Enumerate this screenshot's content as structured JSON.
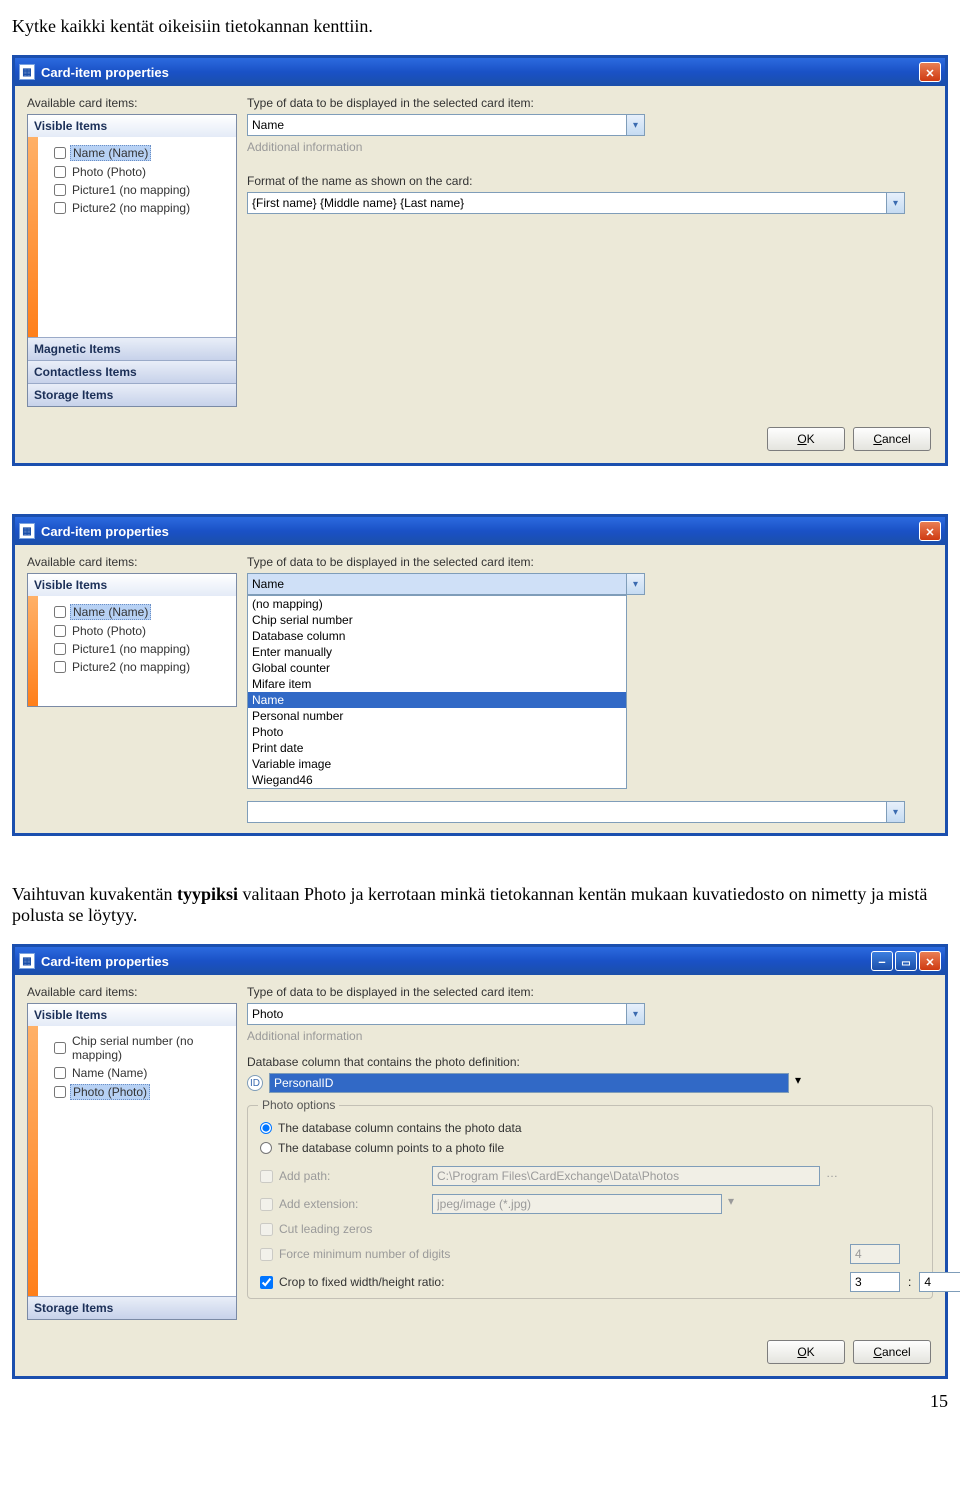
{
  "page": {
    "number": "15"
  },
  "intro_top": "Kytke kaikki kentät oikeisiin tietokannan kenttiin.",
  "intro_mid_1": "Vaihtuvan kuvakentän ",
  "intro_mid_bold": "tyypiksi",
  "intro_mid_2": " valitaan Photo ja kerrotaan minkä tietokannan kentän mukaan kuvatiedosto on nimetty ja mistä polusta se löytyy.",
  "dlg": {
    "title": "Card-item properties",
    "available_label": "Available card items:",
    "type_label": "Type of data to be displayed in the selected card item:",
    "additional_label": "Additional information",
    "format_label": "Format of the name as shown on the card:",
    "ok": "OK",
    "cancel": "Cancel",
    "sections": {
      "visible": "Visible Items",
      "magnetic": "Magnetic Items",
      "contactless": "Contactless Items",
      "storage": "Storage Items"
    }
  },
  "s1": {
    "type_value": "Name",
    "format_value": "{First name} {Middle name} {Last name}",
    "items": [
      "Name (Name)",
      "Photo (Photo)",
      "Picture1 (no mapping)",
      "Picture2 (no mapping)"
    ]
  },
  "s2": {
    "type_value": "Name",
    "items": [
      "Name (Name)",
      "Photo (Photo)",
      "Picture1 (no mapping)",
      "Picture2 (no mapping)"
    ],
    "options": [
      "(no mapping)",
      "Chip serial number",
      "Database column",
      "Enter manually",
      "Global counter",
      "Mifare item",
      "Name",
      "Personal number",
      "Photo",
      "Print date",
      "Variable image",
      "Wiegand46"
    ],
    "selected_option": "Name"
  },
  "s3": {
    "type_value": "Photo",
    "items": [
      "Chip serial number (no mapping)",
      "Name (Name)",
      "Photo (Photo)"
    ],
    "db_label": "Database column that contains the photo definition:",
    "db_id_hint": "ID",
    "db_value": "PersonalID",
    "group_title": "Photo options",
    "radio1": "The database column contains the photo data",
    "radio2": "The database column points to a photo file",
    "addpath_label": "Add path:",
    "addpath_value": "C:\\Program Files\\CardExchange\\Data\\Photos",
    "addext_label": "Add extension:",
    "addext_value": "jpeg/image (*.jpg)",
    "cutzeros_label": "Cut leading zeros",
    "forcemin_label": "Force minimum number of digits",
    "forcemin_value": "4",
    "crop_label": "Crop to fixed width/height ratio:",
    "crop_w": "3",
    "crop_h": "4"
  }
}
